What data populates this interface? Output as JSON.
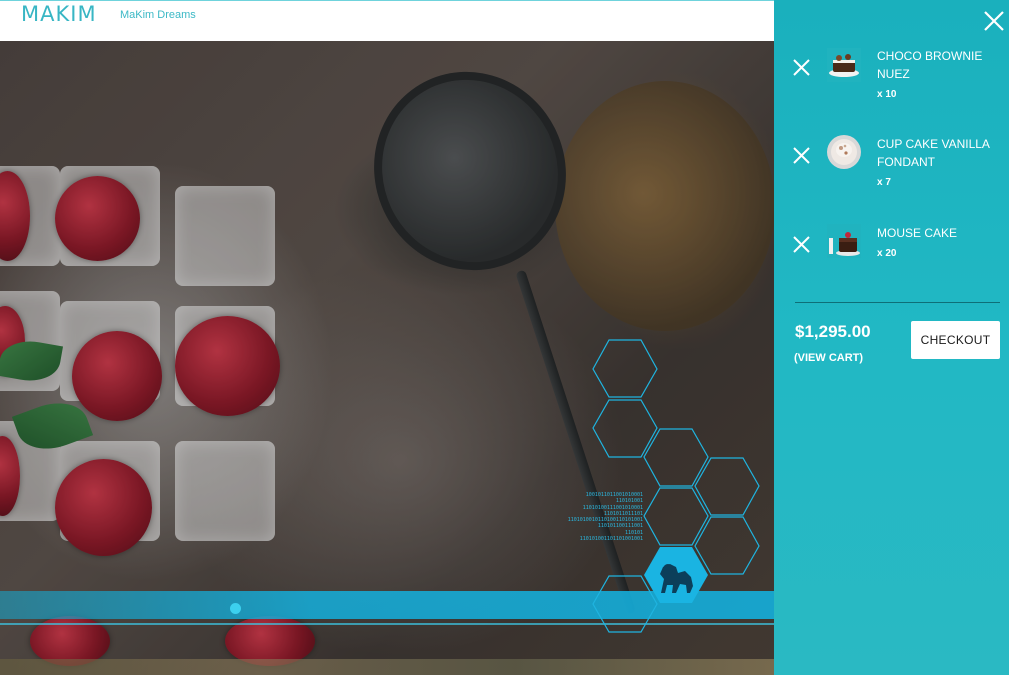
{
  "header": {
    "logo": "MAKIM",
    "tagline": "MaKim Dreams"
  },
  "hero": {
    "binary_text": "1001011011001010001\n110101001\n11010100111001010001\n1101011011101\n1101010010110100110101001\n110101100111001\n110101\n110101001101101001001"
  },
  "cart": {
    "items": [
      {
        "name": "CHOCO BROWNIE NUEZ",
        "qty": "x 10",
        "thumb": "brownie-thumbnail"
      },
      {
        "name": "CUP CAKE VANILLA FONDANT",
        "qty": "x 7",
        "thumb": "cupcake-thumbnail"
      },
      {
        "name": "MOUSE CAKE",
        "qty": "x 20",
        "thumb": "mousse-cake-thumbnail"
      }
    ],
    "total": "$1,295.00",
    "view_cart_label": "(VIEW CART)",
    "checkout_label": "CHECKOUT"
  },
  "colors": {
    "accent": "#1ab0bd",
    "logo": "#38b6c4",
    "band": "#14afdc"
  },
  "icons": [
    "close-icon",
    "remove-item-icon"
  ]
}
